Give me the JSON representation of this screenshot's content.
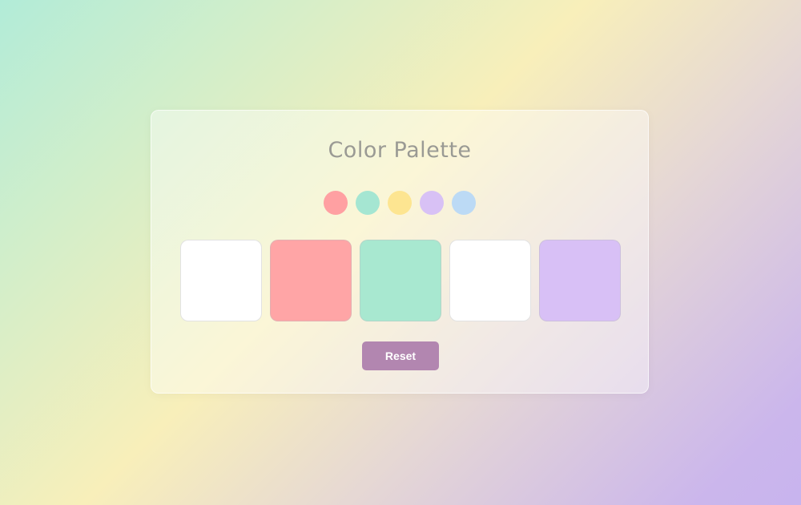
{
  "title": "Color Palette",
  "palette": [
    {
      "name": "pink",
      "color": "#ffa0a2"
    },
    {
      "name": "mint",
      "color": "#a5e6d2"
    },
    {
      "name": "yellow",
      "color": "#fde591"
    },
    {
      "name": "lavender",
      "color": "#d8c1f5"
    },
    {
      "name": "light-blue",
      "color": "#bcdaf5"
    }
  ],
  "slots": [
    {
      "color": "#ffffff"
    },
    {
      "color": "#ffa5a6"
    },
    {
      "color": "#a8e8d0"
    },
    {
      "color": "#ffffff"
    },
    {
      "color": "#d8c0f6"
    }
  ],
  "reset_button": {
    "label": "Reset",
    "color": "#b286b0"
  }
}
